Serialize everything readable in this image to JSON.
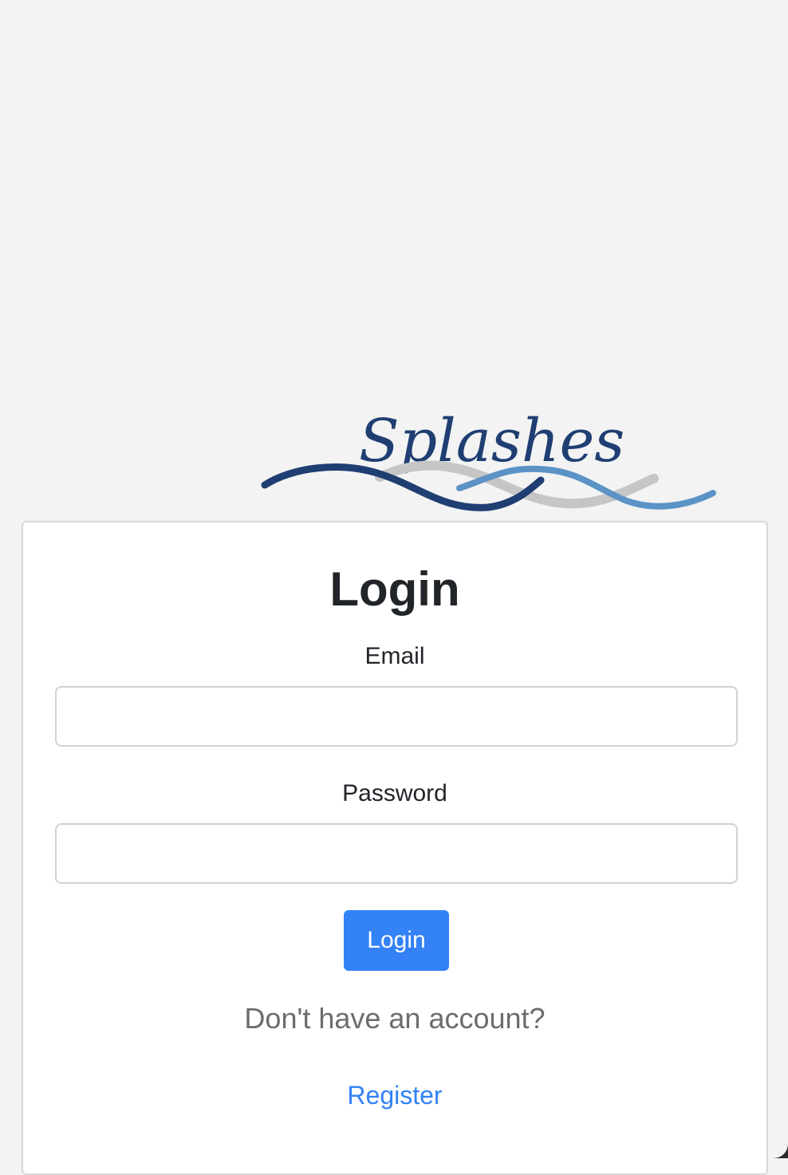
{
  "brand": {
    "logo_text": "Splashes",
    "colors": {
      "navy": "#1f3f73",
      "silver": "#c6c6c6",
      "sky": "#5c93c6"
    }
  },
  "login_form": {
    "title": "Login",
    "email_label": "Email",
    "email_value": "",
    "password_label": "Password",
    "password_value": "",
    "submit_label": "Login",
    "account_prompt": "Don't have an account?",
    "register_link": "Register"
  },
  "colors": {
    "background": "#f3f3f3",
    "card": "#ffffff",
    "primary": "#3382f6",
    "text": "#212529",
    "muted": "#6c6c6c"
  }
}
